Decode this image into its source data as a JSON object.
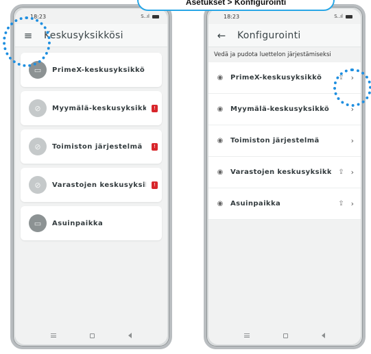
{
  "callout": {
    "text": "Asetukset > Konfigurointi"
  },
  "left_phone": {
    "status": {
      "time": "18:23",
      "signal": "S..ıl"
    },
    "appbar": {
      "menu_icon": "hamburger-icon",
      "title": "Keskusyksikkösi"
    },
    "items": [
      {
        "label": "PrimeX-keskusyksikkö",
        "icon": "panel-icon",
        "dim": false,
        "alert": ""
      },
      {
        "label": "Myymälä-keskusyksikkö",
        "icon": "offline-icon",
        "dim": true,
        "alert": "!"
      },
      {
        "label": "Toimiston järjestelmä",
        "icon": "offline-icon",
        "dim": true,
        "alert": "!"
      },
      {
        "label": "Varastojen keskusyksikkö",
        "icon": "offline-icon",
        "dim": true,
        "alert": "!"
      },
      {
        "label": "Asuinpaikka",
        "icon": "panel-icon",
        "dim": false,
        "alert": ""
      }
    ]
  },
  "right_phone": {
    "status": {
      "time": "18:23",
      "signal": "S..ıl"
    },
    "appbar": {
      "back_icon": "back-arrow-icon",
      "title": "Konfigurointi"
    },
    "hint": "Vedä ja pudota luettelon järjestämiseksi",
    "rows": [
      {
        "label": "PrimeX-keskusyksikkö",
        "share": true
      },
      {
        "label": "Myymälä-keskusyksikkö",
        "share": false
      },
      {
        "label": "Toimiston järjestelmä",
        "share": false
      },
      {
        "label": "Varastojen keskusyksikkö",
        "share": true
      },
      {
        "label": "Asuinpaikka",
        "share": true
      }
    ]
  },
  "colors": {
    "accent": "#27a6e6",
    "highlight": "#1f8fe0",
    "alert": "#d8262b"
  }
}
